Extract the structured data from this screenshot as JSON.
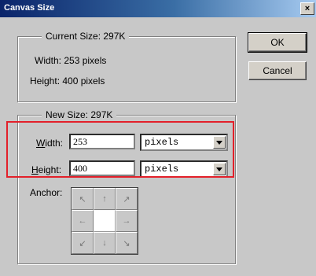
{
  "window": {
    "title": "Canvas Size",
    "close_glyph": "×"
  },
  "current_size": {
    "legend": "Current Size:  297K",
    "width_text": "Width:  253 pixels",
    "height_text": "Height:  400 pixels"
  },
  "new_size": {
    "legend": "New Size:  297K",
    "width_label_key": "W",
    "width_label_rest": "idth:",
    "width_value": "253",
    "width_unit": "pixels",
    "height_label_key": "H",
    "height_label_rest": "eight:",
    "height_value": "400",
    "height_unit": "pixels",
    "anchor_label": "Anchor:",
    "anchor_arrows": [
      "↖",
      "↑",
      "↗",
      "←",
      "",
      "→",
      "↙",
      "↓",
      "↘"
    ]
  },
  "buttons": {
    "ok": "OK",
    "cancel": "Cancel"
  },
  "colors": {
    "highlight": "#e3202a",
    "title_bar": "#0a246a"
  }
}
